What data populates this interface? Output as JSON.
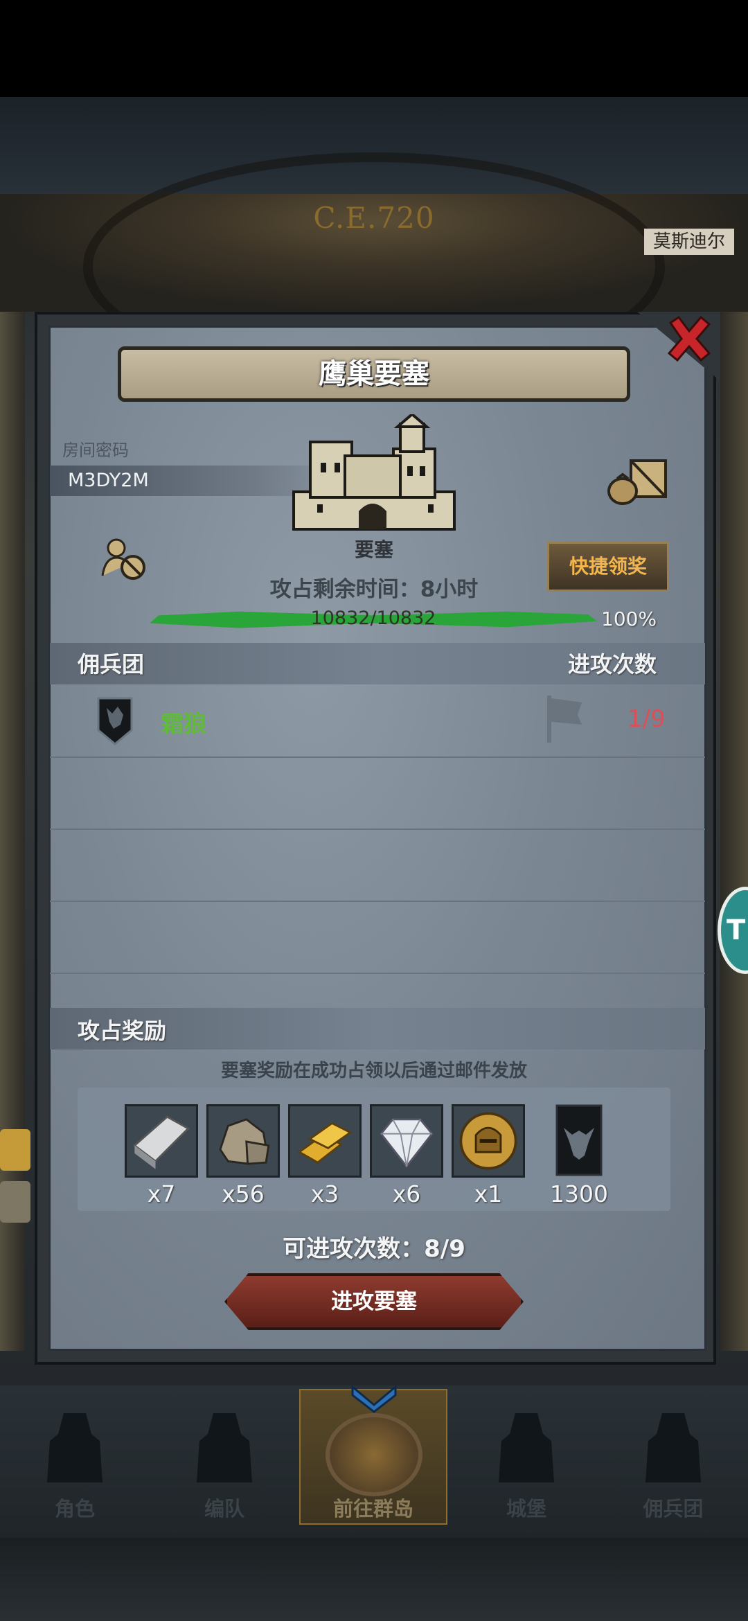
{
  "background": {
    "era": "C.E.720",
    "right_tag": "莫斯迪尔",
    "side_button": "T"
  },
  "dialog": {
    "title": "鹰巢要塞",
    "room_code_label": "房间密码",
    "room_code": "M3DY2M",
    "building_label": "要塞",
    "quick_claim": "快捷领奖",
    "time_remaining": "攻占剩余时间：8小时",
    "hp": "10832/10832",
    "hp_fraction": 1.0,
    "hp_percent": "100%",
    "mercenary_header": "佣兵团",
    "attack_count_header": "进攻次数",
    "mercenaries": [
      {
        "name": "霜狼",
        "attacks": "1/9"
      }
    ],
    "reward_header": "攻占奖励",
    "reward_note": "要塞奖励在成功占领以后通过邮件发放",
    "rewards": [
      {
        "icon": "silver-ingot-icon",
        "qty": "x7"
      },
      {
        "icon": "stone-icon",
        "qty": "x56"
      },
      {
        "icon": "gold-bars-icon",
        "qty": "x3"
      },
      {
        "icon": "diamond-icon",
        "qty": "x6"
      },
      {
        "icon": "knight-helmet-coin-icon",
        "qty": "x1"
      },
      {
        "icon": "bull-banner-icon",
        "qty": "1300"
      }
    ],
    "remaining_attacks": "可进攻次数：8/9",
    "attack_button": "进攻要塞"
  },
  "nav": {
    "items": [
      {
        "label": "角色"
      },
      {
        "label": "编队"
      },
      {
        "label": "前往群岛"
      },
      {
        "label": "城堡"
      },
      {
        "label": "佣兵团"
      }
    ]
  },
  "colors": {
    "accent_green": "#5fbc36",
    "attack_red": "#d9505a",
    "quick_btn_text": "#f3b64f"
  }
}
